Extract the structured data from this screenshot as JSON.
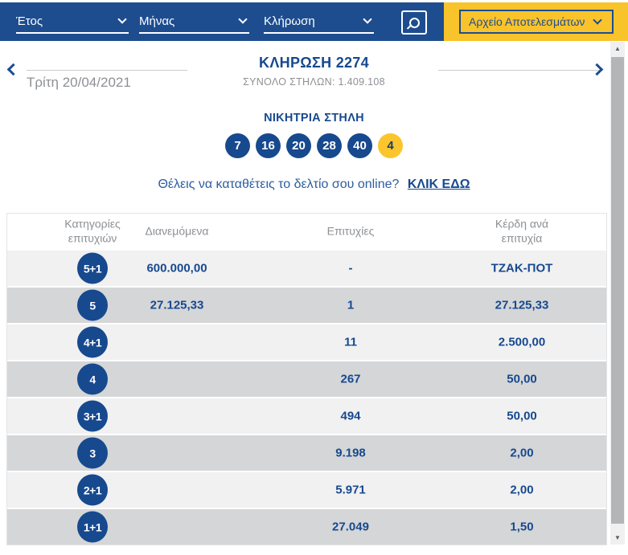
{
  "topbar": {
    "dropdowns": [
      {
        "label": "Έτος"
      },
      {
        "label": "Μήνας"
      },
      {
        "label": "Κλήρωση"
      }
    ],
    "archive_button_label": "Αρχείο Αποτελεσμάτων"
  },
  "draw_header": {
    "title": "ΚΛΗΡΩΣΗ 2274",
    "subtitle": "ΣΥΝΟΛΟ ΣΤΗΛΩΝ: 1.409.108",
    "date": "Τρίτη 20/04/2021"
  },
  "winning": {
    "title": "ΝΙΚΗΤΡΙΑ ΣΤΗΛΗ",
    "numbers": [
      "7",
      "16",
      "20",
      "28",
      "40"
    ],
    "joker": "4"
  },
  "cta": {
    "text": "Θέλεις να καταθέτεις το δελτίο σου online?",
    "link": "ΚΛΙΚ ΕΔΩ"
  },
  "table": {
    "headers": {
      "categories": "Κατηγορίες επιτυχιών",
      "distributed": "Διανεμόμενα",
      "winners": "Επιτυχίες",
      "prize": "Κέρδη ανά επιτυχία"
    },
    "rows": [
      {
        "category": "5+1",
        "distributed": "600.000,00",
        "winners": "-",
        "prize": "ΤΖΑΚ-ΠΟΤ"
      },
      {
        "category": "5",
        "distributed": "27.125,33",
        "winners": "1",
        "prize": "27.125,33"
      },
      {
        "category": "4+1",
        "distributed": "",
        "winners": "11",
        "prize": "2.500,00"
      },
      {
        "category": "4",
        "distributed": "",
        "winners": "267",
        "prize": "50,00"
      },
      {
        "category": "3+1",
        "distributed": "",
        "winners": "494",
        "prize": "50,00"
      },
      {
        "category": "3",
        "distributed": "",
        "winners": "9.198",
        "prize": "2,00"
      },
      {
        "category": "2+1",
        "distributed": "",
        "winners": "5.971",
        "prize": "2,00"
      },
      {
        "category": "1+1",
        "distributed": "",
        "winners": "27.049",
        "prize": "1,50"
      }
    ]
  },
  "colors": {
    "bar_blue": "#1d4d8f",
    "accent_yellow": "#f9c32b",
    "text_blue": "#17498e",
    "row_light": "#f1f1f2",
    "row_dark": "#d5d6d8"
  }
}
